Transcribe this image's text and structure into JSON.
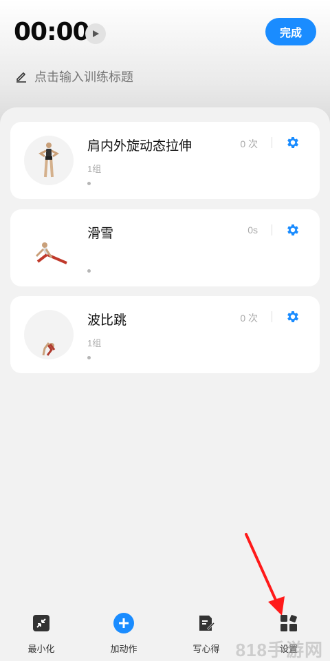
{
  "header": {
    "timer": "00:00",
    "done_label": "完成",
    "title_placeholder": "点击输入训练标题"
  },
  "exercises": [
    {
      "name": "肩内外旋动态拉伸",
      "sets": "1组",
      "count": "0 次"
    },
    {
      "name": "滑雪",
      "sets": "",
      "count": "0s"
    },
    {
      "name": "波比跳",
      "sets": "1组",
      "count": "0 次"
    }
  ],
  "bottom_nav": [
    {
      "label": "最小化",
      "icon": "minimize-icon"
    },
    {
      "label": "加动作",
      "icon": "add-circle-icon"
    },
    {
      "label": "写心得",
      "icon": "note-edit-icon"
    },
    {
      "label": "设置",
      "icon": "grid-settings-icon"
    }
  ],
  "watermark": "818手游网",
  "colors": {
    "accent": "#1a8cff",
    "annotation_arrow": "#ff1a1a"
  }
}
